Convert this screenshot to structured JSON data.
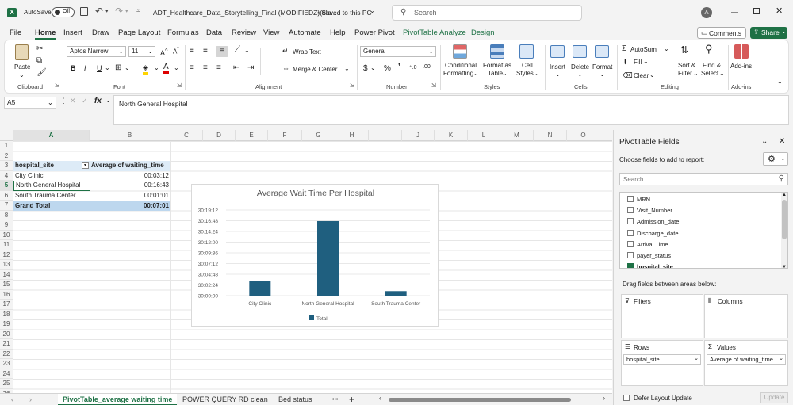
{
  "titlebar": {
    "autosave_label": "AutoSave",
    "autosave_state": "Off",
    "filename": "ADT_Healthcare_Data_Storytelling_Final (MODIFIEDZ)(ola...",
    "save_status": "• Saved to this PC",
    "search_placeholder": "Search",
    "user_initial": "A",
    "colors": {
      "excel_green": "#1e7145",
      "pivot_header": "#ddebf7",
      "pivot_total": "#bdd7ee",
      "bar": "#1f5f7f"
    }
  },
  "menu": {
    "items": [
      "File",
      "Home",
      "Insert",
      "Draw",
      "Page Layout",
      "Formulas",
      "Data",
      "Review",
      "View",
      "Automate",
      "Help",
      "Power Pivot",
      "PivotTable Analyze",
      "Design"
    ],
    "active": "Home",
    "comments_label": "Comments",
    "share_label": "Share"
  },
  "ribbon": {
    "clipboard": {
      "paste": "Paste",
      "label": "Clipboard"
    },
    "font": {
      "name": "Aptos Narrow",
      "size": "11",
      "bold": "B",
      "italic": "I",
      "underline": "U",
      "label": "Font"
    },
    "alignment": {
      "wrap": "Wrap Text",
      "merge": "Merge & Center",
      "label": "Alignment"
    },
    "number": {
      "format": "General",
      "currency": "$",
      "percent": "%",
      "label": "Number"
    },
    "styles": {
      "conditional_line1": "Conditional",
      "conditional_line2": "Formatting",
      "format_table_line1": "Format as",
      "format_table_line2": "Table",
      "cell_styles_line1": "Cell",
      "cell_styles_line2": "Styles",
      "label": "Styles"
    },
    "cells": {
      "insert": "Insert",
      "delete": "Delete",
      "format": "Format",
      "label": "Cells"
    },
    "editing": {
      "autosum": "AutoSum",
      "fill": "Fill",
      "clear": "Clear",
      "sort_line1": "Sort &",
      "sort_line2": "Filter",
      "find_line1": "Find &",
      "find_line2": "Select",
      "label": "Editing"
    },
    "addins": {
      "name": "Add-ins",
      "label": "Add-ins"
    }
  },
  "formula_bar": {
    "name_box": "A5",
    "fx": "fx",
    "content": "North General Hospital"
  },
  "grid": {
    "columns": [
      "A",
      "B",
      "C",
      "D",
      "E",
      "F",
      "G",
      "H",
      "I",
      "J",
      "K",
      "L",
      "M",
      "N",
      "O"
    ],
    "rows": [
      "1",
      "2",
      "3",
      "4",
      "5",
      "6",
      "7",
      "8",
      "9",
      "10",
      "11",
      "12",
      "13",
      "14",
      "15",
      "16",
      "17",
      "18",
      "19",
      "20",
      "21",
      "22",
      "23",
      "24",
      "25",
      "26"
    ],
    "pivot": {
      "header_site": "hospital_site",
      "header_avg": "Average of waiting_time",
      "rows": [
        {
          "site": "City Clinic",
          "avg": "00:03:12"
        },
        {
          "site": "North General Hospital",
          "avg": "00:16:43"
        },
        {
          "site": "South Trauma Center",
          "avg": "00:01:01"
        }
      ],
      "total_label": "Grand Total",
      "total_value": "00:07:01"
    }
  },
  "chart_data": {
    "type": "bar",
    "title": "Average Wait Time Per Hospital",
    "categories": [
      "City Clinic",
      "North General Hospital",
      "South Trauma Center"
    ],
    "series": [
      {
        "name": "Total",
        "values": [
          192,
          1003,
          61
        ],
        "value_unit": "seconds"
      }
    ],
    "y_tick_labels": [
      "30:00:00",
      "30:02:24",
      "30:04:48",
      "30:07:12",
      "30:09:36",
      "30:12:00",
      "30:14:24",
      "30:16:48",
      "30:19:12"
    ],
    "ylim": [
      0,
      1152
    ],
    "y_tick_step": 144,
    "grid": true,
    "legend": "bottom",
    "bar_color": "#1f5f7f"
  },
  "pane": {
    "title": "PivotTable Fields",
    "subtitle": "Choose fields to add to report:",
    "search_placeholder": "Search",
    "fields": [
      {
        "name": "MRN",
        "checked": false
      },
      {
        "name": "Visit_Number",
        "checked": false
      },
      {
        "name": "Admission_date",
        "checked": false
      },
      {
        "name": "Discharge_date",
        "checked": false
      },
      {
        "name": "Arrival Time",
        "checked": false
      },
      {
        "name": "payer_status",
        "checked": false
      },
      {
        "name": "hospital_site",
        "checked": true
      }
    ],
    "drag_label": "Drag fields between areas below:",
    "filters_label": "Filters",
    "columns_label": "Columns",
    "rows_label": "Rows",
    "values_label": "Values",
    "rows_value": "hospital_site",
    "values_value": "Average of waiting_time",
    "defer_label": "Defer Layout Update",
    "update_label": "Update"
  },
  "sheets": {
    "tabs": [
      "PivotTable_average waiting time",
      "POWER QUERY RD clean",
      "Bed status"
    ],
    "active_index": 0,
    "more": "•••",
    "add": "+"
  }
}
